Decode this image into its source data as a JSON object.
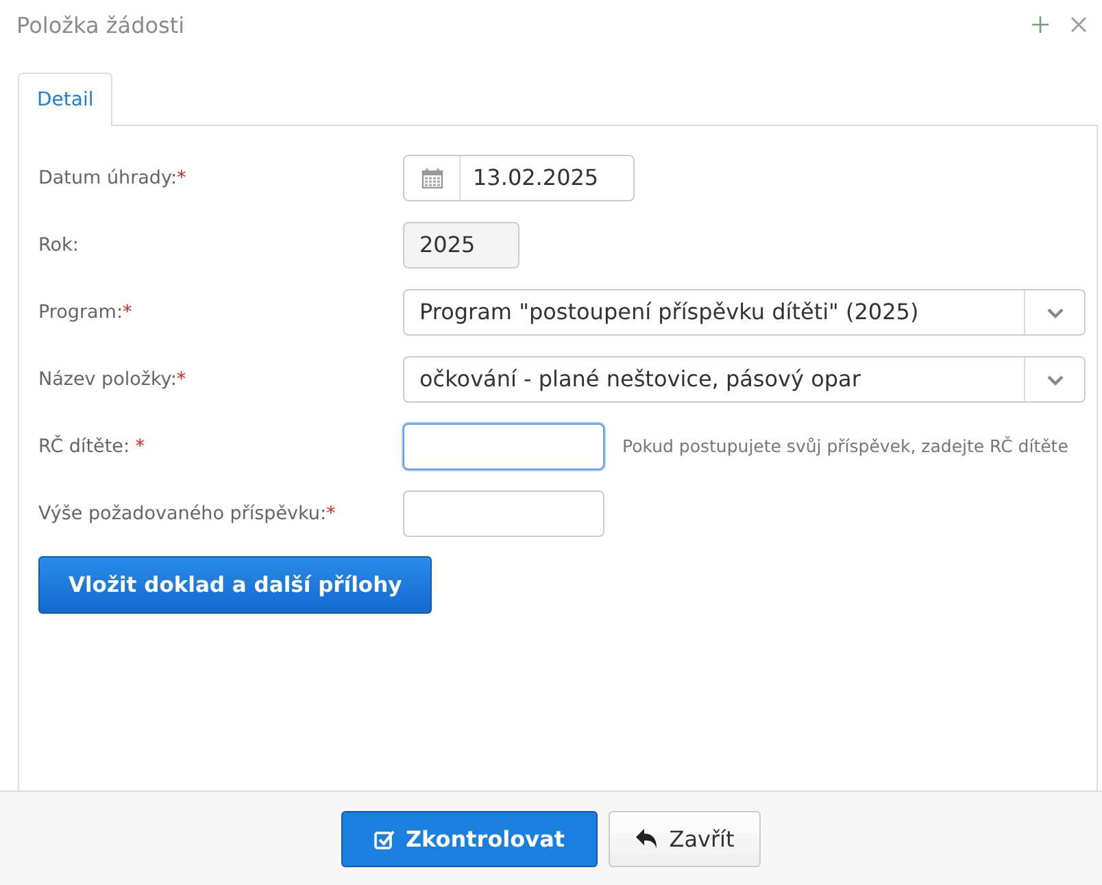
{
  "window": {
    "title": "Položka žádosti"
  },
  "tabs": [
    {
      "label": "Detail",
      "selected": true
    }
  ],
  "fields": [
    {
      "kind": "date",
      "label": "Datum úhrady:",
      "required_mark": "*",
      "value": "13.02.2025"
    },
    {
      "kind": "readonly",
      "label": "Rok:",
      "value": "2025"
    },
    {
      "kind": "select",
      "label": "Program:",
      "required_mark": "*",
      "value": "Program \"postoupení příspěvku dítěti\" (2025)"
    },
    {
      "kind": "select",
      "label": "Název položky:",
      "required_mark": "*",
      "value": "očkování - plané neštovice, pásový opar"
    },
    {
      "kind": "text",
      "label": "RČ dítěte: ",
      "required_mark": "*",
      "focused": true,
      "hint": "Pokud postupujete svůj příspěvek, zadejte RČ dítěte"
    },
    {
      "kind": "text",
      "label": "Výše požadovaného příspěvku:",
      "required_mark": "*",
      "focused": false
    }
  ],
  "attach_button": "Vložit doklad a další přílohy",
  "footer": {
    "check_button": "Zkontrolovat",
    "close_button": "Zavřít"
  }
}
